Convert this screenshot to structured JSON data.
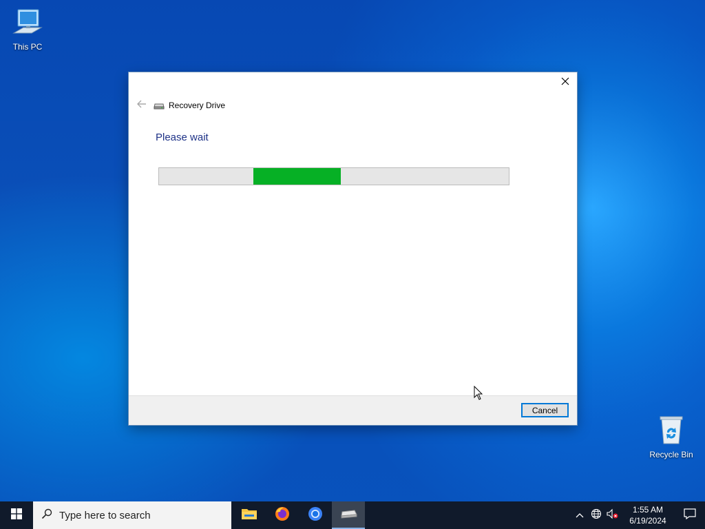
{
  "desktop": {
    "icons": [
      {
        "label": "This PC",
        "icon": "computer-icon"
      },
      {
        "label": "Recycle Bin",
        "icon": "recycle-bin-icon"
      }
    ]
  },
  "dialog": {
    "title": "Recovery Drive",
    "heading": "Please wait",
    "progress": {
      "start_fraction": 0.27,
      "end_fraction": 0.52,
      "color": "#06b025"
    },
    "cancel_label": "Cancel"
  },
  "taskbar": {
    "search_placeholder": "Type here to search",
    "apps": [
      "file-explorer-icon",
      "firefox-icon",
      "chrome-icon",
      "recovery-drive-icon"
    ],
    "clock": {
      "time": "1:55 AM",
      "date": "6/19/2024"
    }
  }
}
